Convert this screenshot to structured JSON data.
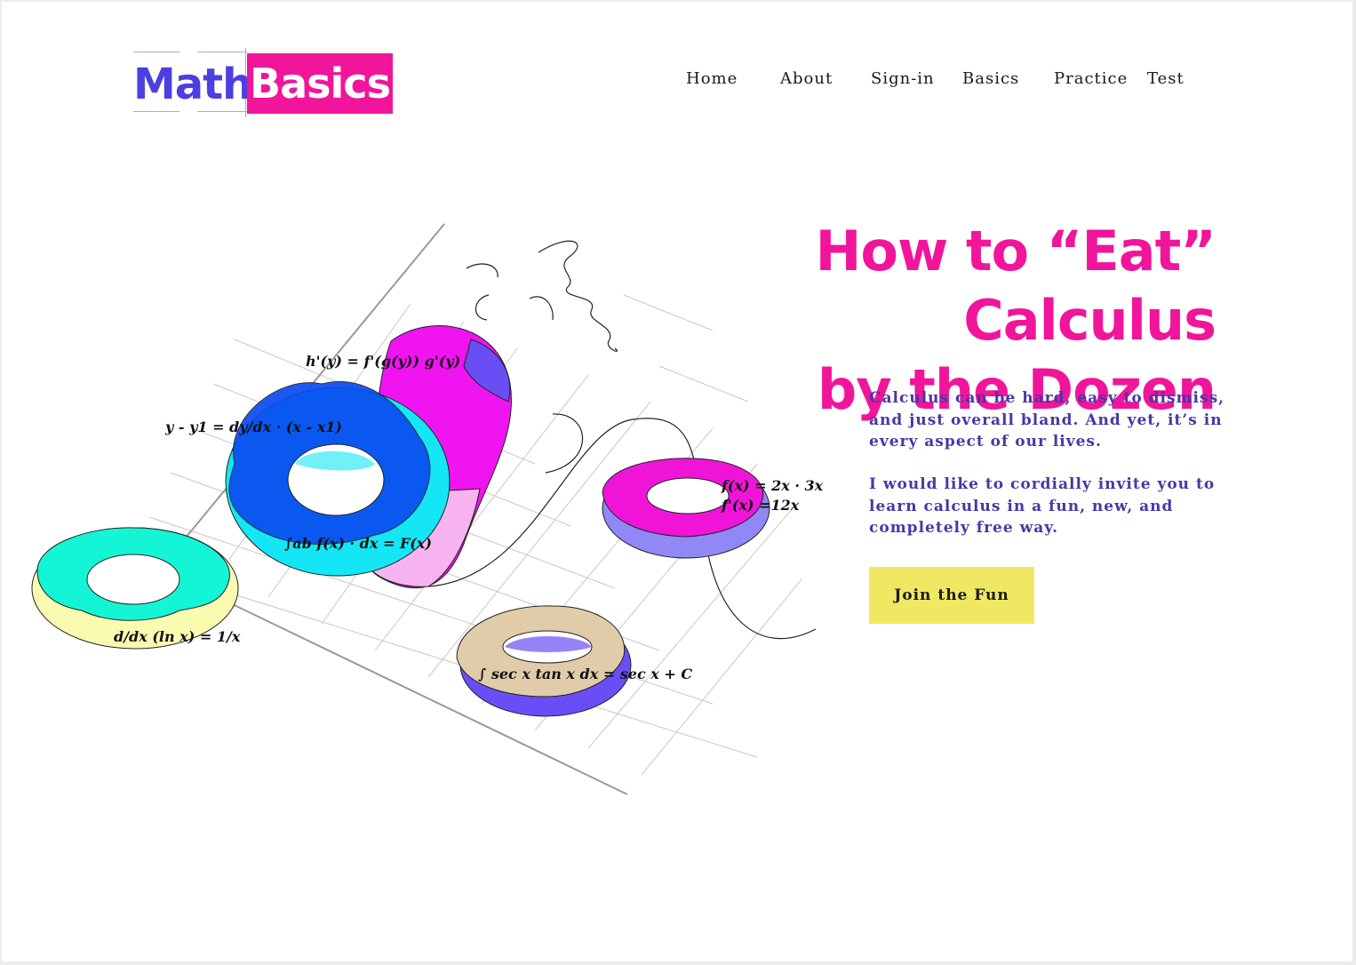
{
  "brand": {
    "math": "Math",
    "basics": "Basics",
    "colors": {
      "purple": "#4b3fe0",
      "pink": "#f0159a"
    }
  },
  "nav": [
    {
      "label": "Home"
    },
    {
      "label": "About"
    },
    {
      "label": "Sign-in"
    },
    {
      "label": "Basics"
    },
    {
      "label": "Practice"
    },
    {
      "label": "Test"
    }
  ],
  "hero": {
    "title_line1": "How to “Eat” Calculus",
    "title_line2": "by the Dozen",
    "paragraph1": "Calculus can be hard, easy to dismiss, and just overall bland. And yet, it’s in every aspect of our lives.",
    "paragraph2": "I would like to cordially invite you to learn calculus in a fun, new, and completely free way.",
    "cta_label": "Join the Fun",
    "cta_color": "#f0e862",
    "text_color": "#4a36a8"
  },
  "illustration": {
    "equations": {
      "chain_rule": "h'(y) = f'(g(y)) g'(y)",
      "tangent_line": "y - y1 = dy/dx · (x - x1)",
      "integral": "∫ab f(x) · dx = F(x)",
      "ln_derivative": "d/dx (ln x) = 1/x",
      "func": "f(x) = 2x · 3x",
      "func_derivative": "f'(x) =12x",
      "sec_integral": "∫ sec x tan x dx = sec x + C"
    }
  }
}
